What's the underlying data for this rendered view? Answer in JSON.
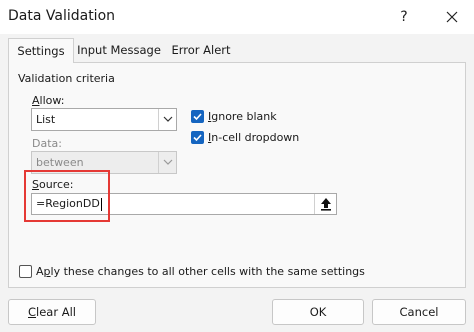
{
  "window": {
    "title": "Data Validation",
    "help_label": "?"
  },
  "tabs": [
    {
      "label": "Settings",
      "active": true
    },
    {
      "label": "Input Message",
      "active": false
    },
    {
      "label": "Error Alert",
      "active": false
    }
  ],
  "settings": {
    "section_title": "Validation criteria",
    "allow": {
      "label_prefix": "",
      "label_mnemonic": "A",
      "label_rest": "llow:",
      "value": "List"
    },
    "data": {
      "label": "Data:",
      "value": "between",
      "disabled": true
    },
    "ignore_blank": {
      "mnemonic": "I",
      "rest": "gnore blank",
      "checked": true
    },
    "in_cell_dropdown": {
      "mnemonic": "I",
      "rest": "n-cell dropdown",
      "checked": true
    },
    "source": {
      "label_mnemonic": "S",
      "label_rest": "ource:",
      "value": "=RegionDD"
    },
    "apply_all": {
      "prefix": "Ap",
      "mnemonic": "p",
      "rest": "ly these changes to all other cells with the same settings",
      "checked": false
    }
  },
  "buttons": {
    "clear_all": {
      "mnemonic": "C",
      "rest": "lear All"
    },
    "ok": "OK",
    "cancel": "Cancel"
  },
  "colors": {
    "checkbox_accent": "#1565c0",
    "highlight": "#e53935"
  }
}
